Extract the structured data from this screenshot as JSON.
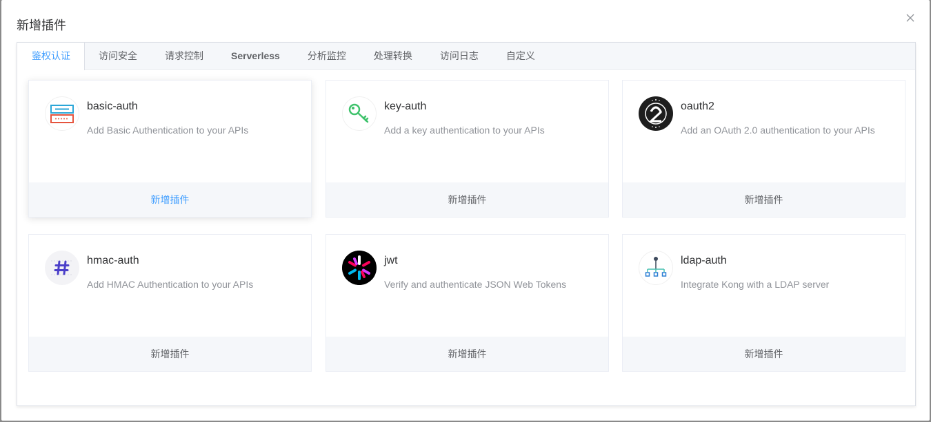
{
  "modal": {
    "title": "新增插件"
  },
  "tabs": [
    {
      "label": "鉴权认证",
      "active": true
    },
    {
      "label": "访问安全",
      "active": false
    },
    {
      "label": "请求控制",
      "active": false
    },
    {
      "label": "Serverless",
      "active": false
    },
    {
      "label": "分析监控",
      "active": false
    },
    {
      "label": "处理转换",
      "active": false
    },
    {
      "label": "访问日志",
      "active": false
    },
    {
      "label": "自定义",
      "active": false
    }
  ],
  "plugins": [
    {
      "name": "basic-auth",
      "description": "Add Basic Authentication to your APIs",
      "action": "新增插件",
      "icon": "basic-auth-icon"
    },
    {
      "name": "key-auth",
      "description": "Add a key authentication to your APIs",
      "action": "新增插件",
      "icon": "key-icon"
    },
    {
      "name": "oauth2",
      "description": "Add an OAuth 2.0 authentication to your APIs",
      "action": "新增插件",
      "icon": "oauth2-icon"
    },
    {
      "name": "hmac-auth",
      "description": "Add HMAC Authentication to your APIs",
      "action": "新增插件",
      "icon": "hash-icon"
    },
    {
      "name": "jwt",
      "description": "Verify and authenticate JSON Web Tokens",
      "action": "新增插件",
      "icon": "jwt-icon"
    },
    {
      "name": "ldap-auth",
      "description": "Integrate Kong with a LDAP server",
      "action": "新增插件",
      "icon": "ldap-tree-icon"
    }
  ],
  "colors": {
    "accent": "#409eff",
    "text_primary": "#303133",
    "text_secondary": "#909399",
    "footer_bg": "#f5f7fa"
  }
}
